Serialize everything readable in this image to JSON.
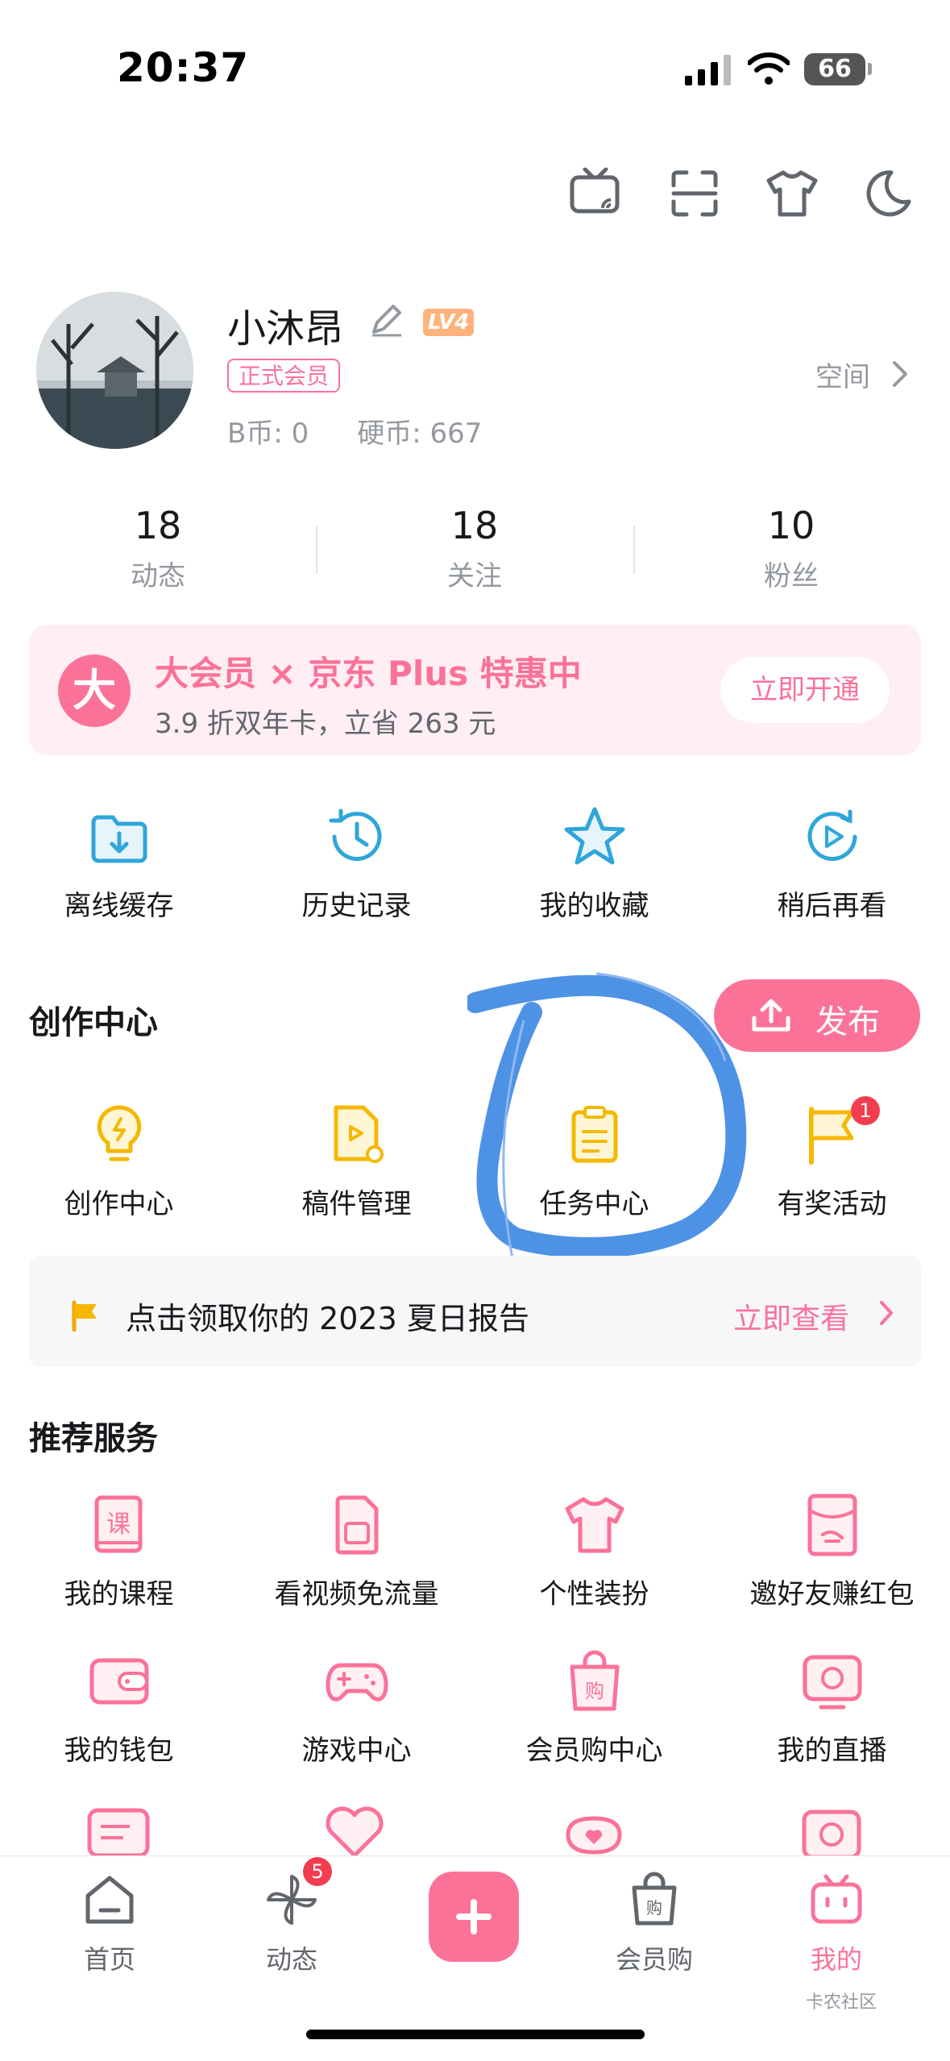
{
  "status_bar": {
    "time": "20:37",
    "battery": "66"
  },
  "profile": {
    "username": "小沐昂",
    "level": "LV4",
    "member_tag": "正式会员",
    "b_coin": "B币: 0",
    "hard_coin": "硬币: 667",
    "space_label": "空间"
  },
  "stats": [
    {
      "num": "18",
      "label": "动态"
    },
    {
      "num": "18",
      "label": "关注"
    },
    {
      "num": "10",
      "label": "粉丝"
    }
  ],
  "vip_banner": {
    "icon_text": "大",
    "title": "大会员 × 京东 Plus 特惠中",
    "subtitle": "3.9 折双年卡，立省 263 元",
    "button": "立即开通"
  },
  "quick_actions": [
    {
      "label": "离线缓存",
      "icon": "download-folder-icon"
    },
    {
      "label": "历史记录",
      "icon": "history-clock-icon"
    },
    {
      "label": "我的收藏",
      "icon": "star-icon"
    },
    {
      "label": "稍后再看",
      "icon": "watch-later-icon"
    }
  ],
  "creation": {
    "title": "创作中心",
    "publish_label": "发布",
    "items": [
      {
        "label": "创作中心",
        "icon": "lightbulb-icon"
      },
      {
        "label": "稿件管理",
        "icon": "manuscript-icon"
      },
      {
        "label": "任务中心",
        "icon": "clipboard-icon"
      },
      {
        "label": "有奖活动",
        "icon": "flag-icon",
        "badge": "1"
      }
    ]
  },
  "report_banner": {
    "text": "点击领取你的 2023 夏日报告",
    "link": "立即查看"
  },
  "services": {
    "title": "推荐服务",
    "items": [
      {
        "label": "我的课程",
        "icon": "course-book-icon"
      },
      {
        "label": "看视频免流量",
        "icon": "sim-card-icon"
      },
      {
        "label": "个性装扮",
        "icon": "tshirt-icon"
      },
      {
        "label": "邀好友赚红包",
        "icon": "red-packet-icon"
      },
      {
        "label": "我的钱包",
        "icon": "wallet-icon"
      },
      {
        "label": "游戏中心",
        "icon": "gamepad-icon"
      },
      {
        "label": "会员购中心",
        "icon": "shopping-bag-icon"
      },
      {
        "label": "我的直播",
        "icon": "live-tv-icon"
      }
    ]
  },
  "tabbar": [
    {
      "label": "首页",
      "icon": "home-icon"
    },
    {
      "label": "动态",
      "icon": "pinwheel-icon",
      "badge": "5"
    },
    {
      "label": "会员购",
      "icon": "bag-icon"
    },
    {
      "label": "我的",
      "icon": "tv-mine-icon"
    }
  ],
  "watermark": "卡农社区",
  "colors": {
    "accent": "#fb7299",
    "creation_yellow": "#f5b800",
    "quick_blue": "#2fa6d9"
  }
}
